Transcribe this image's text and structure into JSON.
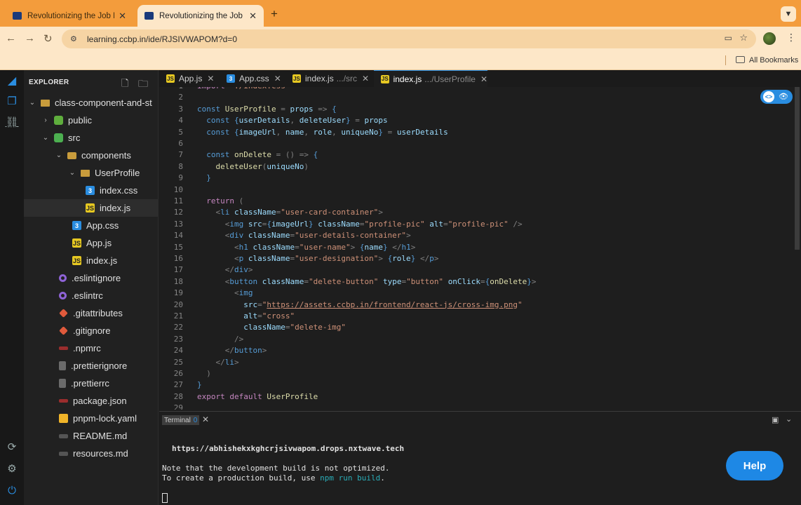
{
  "browser": {
    "tabs": [
      {
        "title": "Revolutionizing the Job Mark",
        "active": false
      },
      {
        "title": "Revolutionizing the Job Mark",
        "active": true
      }
    ],
    "new_tab": "+",
    "url": "learning.ccbp.in/ide/RJSIVWAPOM?d=0",
    "bookmarks_label": "All Bookmarks"
  },
  "explorer": {
    "title": "EXPLORER",
    "items": [
      {
        "label": "class-component-and-st",
        "icon": "folder-icon",
        "depth": 0,
        "chev": "v"
      },
      {
        "label": "public",
        "icon": "public-folder-icon",
        "depth": 1,
        "chev": ">"
      },
      {
        "label": "src",
        "icon": "src-folder-icon",
        "depth": 1,
        "chev": "v"
      },
      {
        "label": "components",
        "icon": "components-folder-icon",
        "depth": 2,
        "chev": "v"
      },
      {
        "label": "UserProfile",
        "icon": "folder-icon",
        "depth": 3,
        "chev": "v"
      },
      {
        "label": "index.css",
        "icon": "css-file-icon",
        "depth": 4
      },
      {
        "label": "index.js",
        "icon": "js-file-icon",
        "depth": 4,
        "selected": true
      },
      {
        "label": "App.css",
        "icon": "css-file-icon",
        "depth": 3
      },
      {
        "label": "App.js",
        "icon": "js-file-icon",
        "depth": 3
      },
      {
        "label": "index.js",
        "icon": "js-file-icon",
        "depth": 3
      },
      {
        "label": ".eslintignore",
        "icon": "eslint-icon",
        "depth": 2
      },
      {
        "label": ".eslintrc",
        "icon": "eslint-icon",
        "depth": 2
      },
      {
        "label": ".gitattributes",
        "icon": "git-icon",
        "depth": 2
      },
      {
        "label": ".gitignore",
        "icon": "git-icon",
        "depth": 2
      },
      {
        "label": ".npmrc",
        "icon": "npm-icon",
        "depth": 2
      },
      {
        "label": ".prettierignore",
        "icon": "prettier-icon",
        "depth": 2
      },
      {
        "label": ".prettierrc",
        "icon": "prettier-icon",
        "depth": 2
      },
      {
        "label": "package.json",
        "icon": "npm-icon",
        "depth": 2
      },
      {
        "label": "pnpm-lock.yaml",
        "icon": "pnpm-icon",
        "depth": 2
      },
      {
        "label": "README.md",
        "icon": "markdown-icon",
        "depth": 2
      },
      {
        "label": "resources.md",
        "icon": "markdown-icon",
        "depth": 2
      }
    ]
  },
  "editor_tabs": [
    {
      "label": "App.js",
      "suffix": "",
      "icon": "js",
      "active": false
    },
    {
      "label": "App.css",
      "suffix": "",
      "icon": "css",
      "active": false
    },
    {
      "label": "index.js",
      "suffix": ".../src",
      "icon": "js",
      "active": false
    },
    {
      "label": "index.js",
      "suffix": ".../UserProfile",
      "icon": "js",
      "active": true
    }
  ],
  "code": {
    "first_line": 1,
    "lines": [
      "import './index.css'",
      "",
      "const UserProfile = props => {",
      "  const {userDetails, deleteUser} = props",
      "  const {imageUrl, name, role, uniqueNo} = userDetails",
      "",
      "  const onDelete = () => {",
      "    deleteUser(uniqueNo)",
      "  }",
      "",
      "  return (",
      "    <li className=\"user-card-container\">",
      "      <img src={imageUrl} className=\"profile-pic\" alt=\"profile-pic\" />",
      "      <div className=\"user-details-container\">",
      "        <h1 className=\"user-name\"> {name} </h1>",
      "        <p className=\"user-designation\"> {role} </p>",
      "      </div>",
      "      <button className=\"delete-button\" type=\"button\" onClick={onDelete}>",
      "        <img",
      "          src=\"https://assets.ccbp.in/frontend/react-js/cross-img.png\"",
      "          alt=\"cross\"",
      "          className=\"delete-img\"",
      "        />",
      "      </button>",
      "    </li>",
      "  )",
      "}",
      "export default UserProfile",
      ""
    ]
  },
  "terminal": {
    "tab_label": "Terminal",
    "tab_index": "0",
    "url": "https://abhishekxkghcrjsivwapom.drops.nxtwave.tech",
    "line1": "Note that the development build is not optimized.",
    "line2_prefix": "To create a production build, use ",
    "line2_cmd": "npm run build",
    "line2_suffix": "."
  },
  "help_label": "Help",
  "colors": {
    "browser_accent": "#f39c3c",
    "ide_accent": "#2a8de0",
    "help_button": "#1e88e5"
  }
}
